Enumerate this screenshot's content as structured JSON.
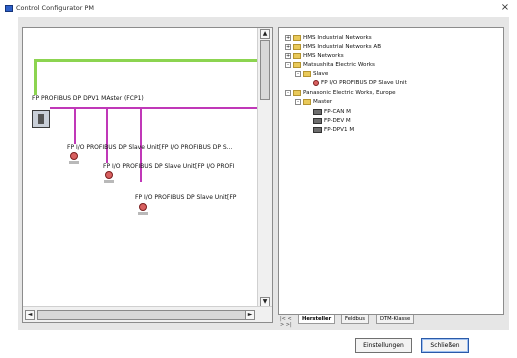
{
  "window": {
    "title": "Control Configurator PM",
    "close_glyph": "×"
  },
  "diagram": {
    "master_label": "FP PROFIBUS DP DPV1 MAster (FCP1)",
    "slaves": [
      {
        "label": "FP I/O PROFIBUS DP Slave Unit[FP I/O PROFIBUS DP S..."
      },
      {
        "label": "FP I/O PROFIBUS DP Slave Unit[FP I/O PROFI"
      },
      {
        "label": "FP I/O PROFIBUS DP Slave Unit[FP"
      }
    ]
  },
  "tree": {
    "items": [
      {
        "depth": 0,
        "kind": "folder",
        "expander": "+",
        "label": "HMS Industrial Networks"
      },
      {
        "depth": 0,
        "kind": "folder",
        "expander": "+",
        "label": "HMS Industrial Networks AB"
      },
      {
        "depth": 0,
        "kind": "folder",
        "expander": "+",
        "label": "HMS Networks"
      },
      {
        "depth": 0,
        "kind": "folder",
        "expander": "-",
        "label": "Matsushita Electric Works"
      },
      {
        "depth": 1,
        "kind": "folder",
        "expander": "-",
        "label": "Slave"
      },
      {
        "depth": 2,
        "kind": "slave",
        "expander": "",
        "label": "FP I/O PROFIBUS DP Slave Unit"
      },
      {
        "depth": 0,
        "kind": "folder",
        "expander": "-",
        "label": "Panasonic Electric Works, Europe"
      },
      {
        "depth": 1,
        "kind": "folder",
        "expander": "-",
        "label": "Master"
      },
      {
        "depth": 2,
        "kind": "device",
        "expander": "",
        "label": "FP-CAN M"
      },
      {
        "depth": 2,
        "kind": "device",
        "expander": "",
        "label": "FP-DEV M"
      },
      {
        "depth": 2,
        "kind": "device",
        "expander": "",
        "label": "FP-DPV1 M"
      }
    ]
  },
  "tabs": {
    "nav": "|< < > >|",
    "items": [
      {
        "label": "Hersteller",
        "active": true
      },
      {
        "label": "Feldbus",
        "active": false
      },
      {
        "label": "DTM-Klasse",
        "active": false
      }
    ]
  },
  "buttons": {
    "settings": "Einstellungen",
    "close": "Schließen"
  },
  "scroll": {
    "up": "▲",
    "down": "▼",
    "left": "◄",
    "right": "►"
  },
  "colors": {
    "bus_green": "#8cd450",
    "bus_pink": "#c038b8",
    "title_icon": "#2d5fc8"
  }
}
